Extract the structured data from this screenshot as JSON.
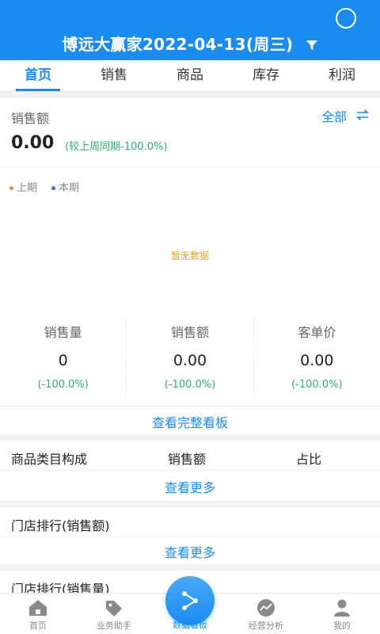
{
  "header": {
    "title": "博远大赢家2022-04-13(周三)"
  },
  "tabs": [
    {
      "label": "首页",
      "active": true
    },
    {
      "label": "销售",
      "active": false
    },
    {
      "label": "商品",
      "active": false
    },
    {
      "label": "库存",
      "active": false
    },
    {
      "label": "利润",
      "active": false
    }
  ],
  "sales": {
    "label": "销售额",
    "all_link": "全部",
    "value": "0.00",
    "compare": "(较上周同期-100.0%)",
    "legend": [
      {
        "label": "上期",
        "color": "#f28b30"
      },
      {
        "label": "本期",
        "color": "#3b6fe0"
      }
    ],
    "no_data": "暂无数据",
    "metrics": [
      {
        "label": "销售量",
        "value": "0",
        "pct": "(-100.0%)"
      },
      {
        "label": "销售额",
        "value": "0.00",
        "pct": "(-100.0%)"
      },
      {
        "label": "客单价",
        "value": "0.00",
        "pct": "(-100.0%)"
      }
    ],
    "full_board": "查看完整看板"
  },
  "category": {
    "col1": "商品类目构成",
    "col2": "销售额",
    "col3": "占比",
    "more": "查看更多"
  },
  "store_rank_amount": {
    "title": "门店排行(销售额)",
    "more": "查看更多"
  },
  "store_rank_qty": {
    "title": "门店排行(销售量)"
  },
  "bottom_nav": [
    {
      "label": "首页",
      "icon": "home-icon"
    },
    {
      "label": "业务助手",
      "icon": "tag-icon"
    },
    {
      "label": "数据看板",
      "icon": "share-icon",
      "active": true
    },
    {
      "label": "经营分析",
      "icon": "analysis-icon"
    },
    {
      "label": "我的",
      "icon": "user-icon"
    }
  ],
  "colors": {
    "primary": "#1a8cf0",
    "positive": "#2ab36b",
    "warning": "#f0a020"
  }
}
